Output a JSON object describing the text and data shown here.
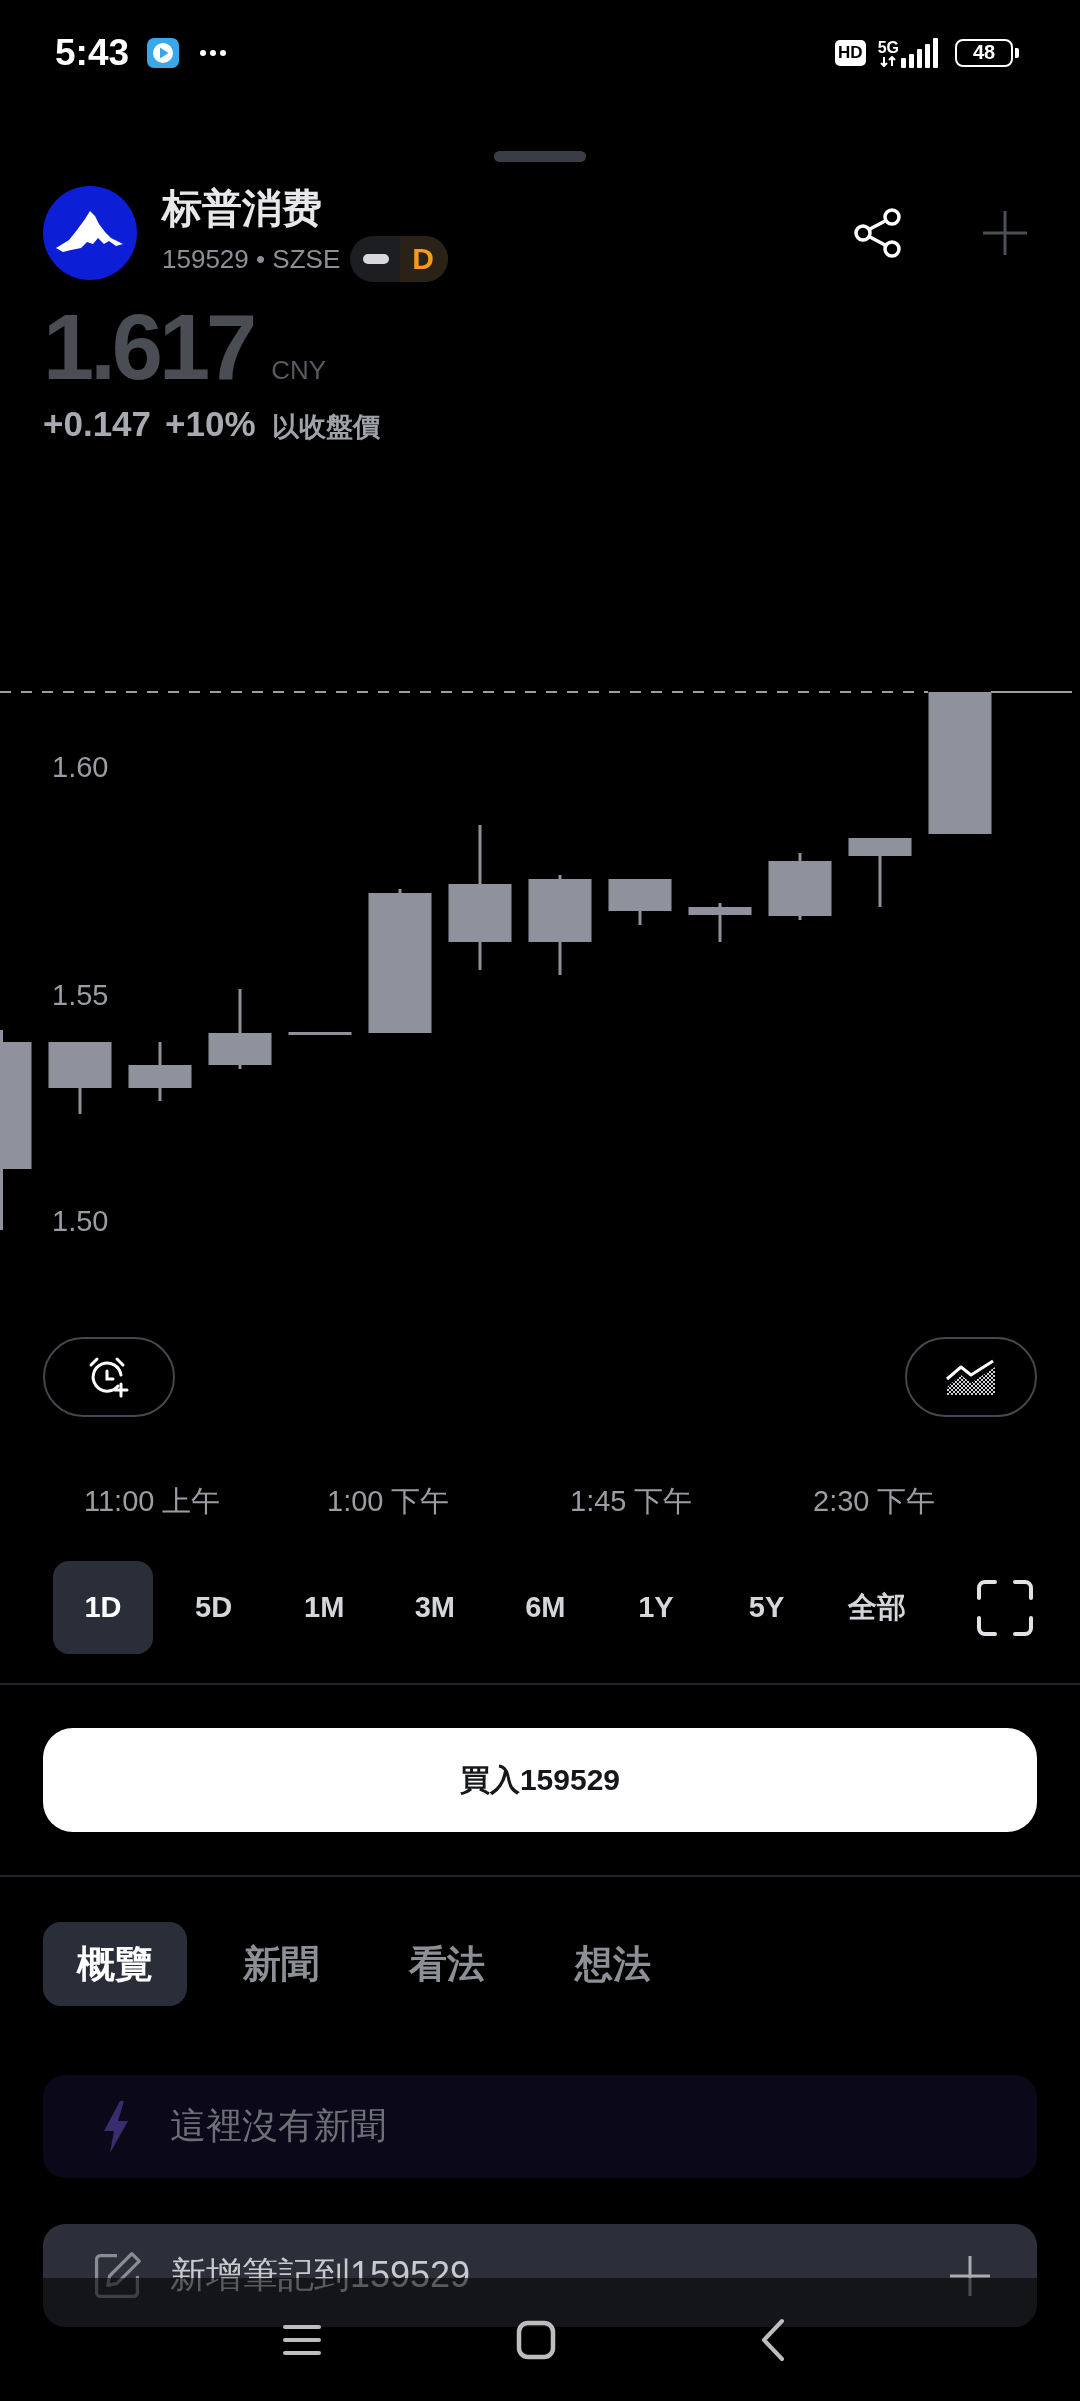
{
  "status_bar": {
    "time": "5:43",
    "hd_badge": "HD",
    "network": "5G",
    "battery": "48"
  },
  "header": {
    "name": "标普消费",
    "symbol_line": "159529 • SZSE",
    "rating": "D"
  },
  "quote": {
    "price": "1.617",
    "currency": "CNY",
    "change": "+0.147",
    "change_percent": "+10%",
    "price_note": "以收盤價"
  },
  "chart": {
    "y_labels": [
      "1.60",
      "1.55",
      "1.50"
    ],
    "time_labels": [
      "11:00 上午",
      "1:00 下午",
      "1:45 下午",
      "2:30 下午"
    ]
  },
  "ranges": [
    {
      "label": "1D",
      "selected": true
    },
    {
      "label": "5D",
      "selected": false
    },
    {
      "label": "1M",
      "selected": false
    },
    {
      "label": "3M",
      "selected": false
    },
    {
      "label": "6M",
      "selected": false
    },
    {
      "label": "1Y",
      "selected": false
    },
    {
      "label": "5Y",
      "selected": false
    },
    {
      "label": "全部",
      "selected": false
    }
  ],
  "buy_button": "買入159529",
  "tabs": [
    {
      "label": "概覽",
      "selected": true
    },
    {
      "label": "新聞",
      "selected": false
    },
    {
      "label": "看法",
      "selected": false
    },
    {
      "label": "想法",
      "selected": false
    }
  ],
  "news_card": {
    "message": "這裡沒有新聞"
  },
  "note_card": {
    "label": "新增筆記到159529"
  }
}
